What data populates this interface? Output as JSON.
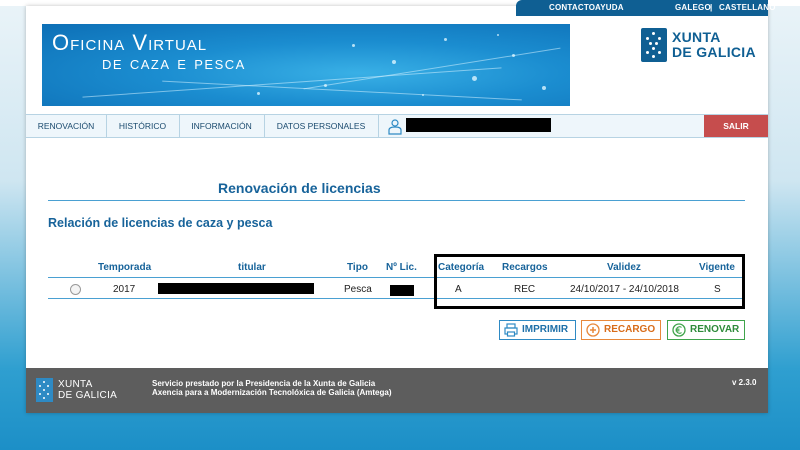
{
  "topbar": {
    "contacto": "CONTACTO",
    "ayuda": "AYUDA",
    "galego": "GALEGO",
    "separator": "|",
    "castellano": "CASTELLANO"
  },
  "banner": {
    "line1": "Oficina Virtual",
    "line2": "de caza e pesca"
  },
  "logo": {
    "line1": "XUNTA",
    "line2": "DE GALICIA"
  },
  "nav": {
    "items": [
      {
        "label": "RENOVACIÓN"
      },
      {
        "label": "HISTÓRICO"
      },
      {
        "label": "INFORMACIÓN"
      },
      {
        "label": "DATOS PERSONALES"
      }
    ],
    "logout": "SALIR"
  },
  "main": {
    "title": "Renovación de licencias",
    "subtitle": "Relación de licencias de caza y pesca",
    "table": {
      "headers": [
        "Temporada",
        "titular",
        "Tipo",
        "Nº Lic.",
        "Categoría",
        "Recargos",
        "Validez",
        "Vigente"
      ],
      "rows": [
        {
          "temporada": "2017",
          "tipo": "Pesca",
          "categoria": "A",
          "recargos": "REC",
          "validez": "24/10/2017 - 24/10/2018",
          "vigente": "S"
        }
      ]
    },
    "buttons": {
      "print": "IMPRIMIR",
      "recargo": "RECARGO",
      "renovar": "RENOVAR"
    }
  },
  "footer": {
    "logo_line1": "XUNTA",
    "logo_line2": "DE GALICIA",
    "service_line1": "Servicio prestado por la Presidencia de la Xunta de Galicia",
    "service_line2": "Axencia para a Modernización Tecnolóxica de Galicia (Amtega)",
    "version": "v 2.3.0"
  },
  "colors": {
    "primary": "#17639a",
    "topbar": "#0f5f93",
    "logout": "#c64d4d",
    "footer": "#5d5d5d"
  }
}
